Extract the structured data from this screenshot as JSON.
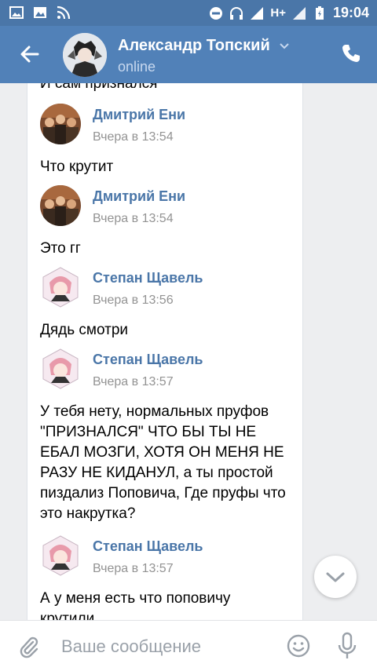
{
  "statusbar": {
    "time": "19:04",
    "network": "H+"
  },
  "header": {
    "title": "Александр Топский",
    "status": "online"
  },
  "chat": {
    "fragment": "И сам признался",
    "messages": [
      {
        "name": "Дмитрий Ени",
        "time": "Вчера в 13:54",
        "text": "Что крутит"
      },
      {
        "name": "Дмитрий Ени",
        "time": "Вчера в 13:54",
        "text": "Это гг"
      },
      {
        "name": "Степан Щавель",
        "time": "Вчера в 13:56",
        "text": "Дядь смотри"
      },
      {
        "name": "Степан Щавель",
        "time": "Вчера в 13:57",
        "text": "У тебя нету, нормальных пруфов \"ПРИЗНАЛСЯ\" ЧТО БЫ ТЫ НЕ ЕБАЛ МОЗГИ, ХОТЯ ОН МЕНЯ НЕ РАЗУ НЕ КИДАНУЛ, а ты простой пиздализ Поповича, Где пруфы что это накрутка?"
      },
      {
        "name": "Степан Щавель",
        "time": "Вчера в 13:57",
        "text": "А у меня есть что поповичу крутили"
      }
    ]
  },
  "input": {
    "placeholder": "Ваше сообщение"
  },
  "colors": {
    "header": "#5181b8",
    "statusbar": "#4a76a8",
    "name": "#4a76a8"
  }
}
